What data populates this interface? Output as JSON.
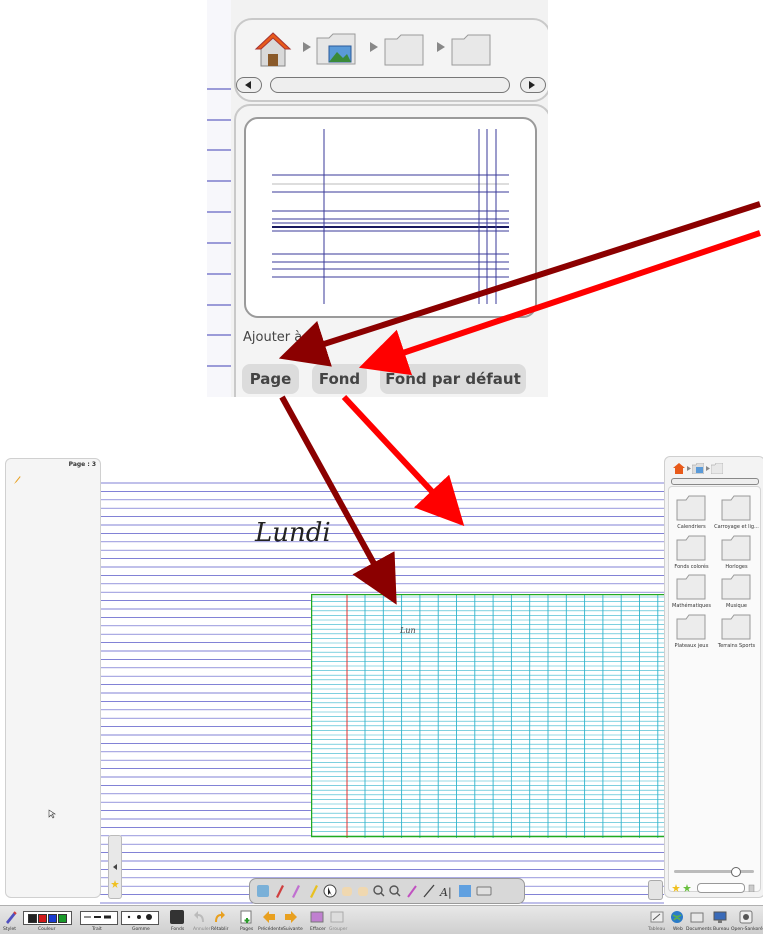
{
  "zoom": {
    "add_label": "Ajouter à",
    "buttons": {
      "page": "Page",
      "background": "Fond",
      "default_background": "Fond par défaut"
    }
  },
  "board": {
    "page_label": "Page : 3",
    "handwriting_title": "Lundi",
    "handwriting_small": "Lun",
    "right_panel": {
      "folders": [
        "Calendriers",
        "Carroyage et lig...",
        "Fonds colorés",
        "Horloges",
        "Mathématiques",
        "Musique",
        "Plateaux jeux",
        "Terrains Sports"
      ]
    },
    "bottom_bar": {
      "labels": {
        "stylet": "Stylet",
        "couleur": "Couleur",
        "trait": "Trait",
        "gomme": "Gomme",
        "fonds": "Fonds",
        "annuler": "Annuler",
        "retablir": "Rétablir",
        "pages": "Pages",
        "precedente": "Précédente",
        "suivante": "Suivante",
        "effacer": "Effacer",
        "grouper": "Grouper",
        "tableau": "Tableau",
        "web": "Web",
        "documents": "Documents",
        "bureau": "Bureau",
        "open_sankore": "Open-Sankoré"
      },
      "colors": [
        "#222222",
        "#d11a1a",
        "#1a3bd1",
        "#1a9a2a"
      ]
    }
  },
  "colors": {
    "arrow_dark": "#8b0000",
    "arrow_bright": "#ff0000",
    "ruling": "#5858c8",
    "seyes_grid": "#30b4cc",
    "seyes_border": "#22aa22",
    "seyes_margin": "#e03030"
  }
}
